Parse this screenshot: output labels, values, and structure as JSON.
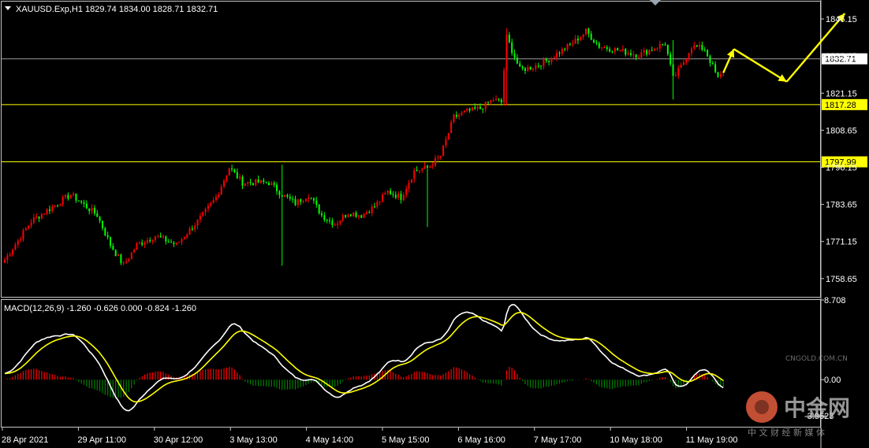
{
  "header": {
    "symbol_info": "XAUUSD.Exp,H1  1829.74 1834.00 1828.71 1832.71",
    "macd_info": "MACD(12,26,9) -1.260 -0.626 0.000 -0.824 -1.260"
  },
  "price_axis": {
    "ticks": [
      "1846.15",
      "1833.65",
      "1821.15",
      "1808.65",
      "1796.15",
      "1783.65",
      "1771.15",
      "1758.65"
    ],
    "current_price": "1832.71",
    "lines": [
      {
        "value": 1832.71,
        "label": "1832.71",
        "color": "#9a9a9a",
        "label_style": "white"
      },
      {
        "value": 1817.28,
        "label": "1817.28",
        "color": "#ffff00",
        "label_style": "yellow"
      },
      {
        "value": 1797.99,
        "label": "1797.99",
        "color": "#ffff00",
        "label_style": "yellow"
      }
    ]
  },
  "macd_axis": {
    "ticks": [
      "8.708",
      "0.00",
      "-3.9623"
    ]
  },
  "time_axis": {
    "labels": [
      "28 Apr 2021",
      "29 Apr 11:00",
      "30 Apr 12:00",
      "3 May 13:00",
      "4 May 14:00",
      "5 May 15:00",
      "6 May 16:00",
      "7 May 17:00",
      "10 May 18:00",
      "11 May 19:00"
    ]
  },
  "watermark": {
    "brand": "中金网",
    "site": "CNGOLD.COM.CN",
    "tagline": "中 文 财 经 新 媒 体"
  },
  "chart_data": [
    {
      "type": "candlestick",
      "symbol": "XAUUSD.Exp",
      "timeframe": "H1",
      "ohlc_last": {
        "open": 1829.74,
        "high": 1834.0,
        "low": 1828.71,
        "close": 1832.71
      },
      "ylim": [
        1752.5,
        1852.0
      ],
      "colors": {
        "up": "#ff0000",
        "down": "#00ff00"
      },
      "close_path": [
        [
          0,
          1765
        ],
        [
          10,
          1778
        ],
        [
          20,
          1784
        ],
        [
          25,
          1787
        ],
        [
          35,
          1780
        ],
        [
          40,
          1770
        ],
        [
          45,
          1763
        ],
        [
          50,
          1770
        ],
        [
          57,
          1773
        ],
        [
          65,
          1770
        ],
        [
          70,
          1775
        ],
        [
          75,
          1780
        ],
        [
          80,
          1786
        ],
        [
          85,
          1796
        ],
        [
          90,
          1791
        ],
        [
          100,
          1791
        ],
        [
          105,
          1787
        ],
        [
          110,
          1784
        ],
        [
          115,
          1787
        ],
        [
          120,
          1780
        ],
        [
          125,
          1777
        ],
        [
          130,
          1781
        ],
        [
          135,
          1780
        ],
        [
          140,
          1783
        ],
        [
          145,
          1788
        ],
        [
          150,
          1786
        ],
        [
          155,
          1795
        ],
        [
          160,
          1796
        ],
        [
          165,
          1800
        ],
        [
          170,
          1813
        ],
        [
          175,
          1815
        ],
        [
          180,
          1816
        ],
        [
          185,
          1819
        ],
        [
          188,
          1818
        ],
        [
          190,
          1840
        ],
        [
          195,
          1829
        ],
        [
          200,
          1830
        ],
        [
          205,
          1832
        ],
        [
          210,
          1835
        ],
        [
          215,
          1838
        ],
        [
          220,
          1842
        ],
        [
          225,
          1837
        ],
        [
          230,
          1836
        ],
        [
          235,
          1835
        ],
        [
          240,
          1834
        ],
        [
          245,
          1836
        ],
        [
          250,
          1838
        ],
        [
          253,
          1826
        ],
        [
          256,
          1830
        ],
        [
          260,
          1837
        ],
        [
          265,
          1836
        ],
        [
          270,
          1826
        ],
        [
          272,
          1828
        ]
      ],
      "spikes": [
        [
          105,
          1763,
          1797
        ],
        [
          160,
          1776,
          1796
        ],
        [
          190,
          1817,
          1843
        ],
        [
          253,
          1819,
          1839
        ]
      ],
      "n_candles": 273
    },
    {
      "type": "macd",
      "params": "12,26,9",
      "values": {
        "macd": -1.26,
        "signal": -0.626,
        "hist": -0.824
      },
      "ylim": [
        -5.15,
        8.708
      ],
      "colors": {
        "macd_line": "#ffffff",
        "signal_line": "#ffff00",
        "hist_positive": "#ff0000",
        "hist_negative": "#008000"
      }
    },
    {
      "type": "annotation",
      "name": "forecast-arrows",
      "color": "#ffff00",
      "points": [
        [
          272,
          1828
        ],
        [
          276,
          1836
        ],
        [
          296,
          1825
        ],
        [
          318,
          1848
        ]
      ]
    }
  ]
}
